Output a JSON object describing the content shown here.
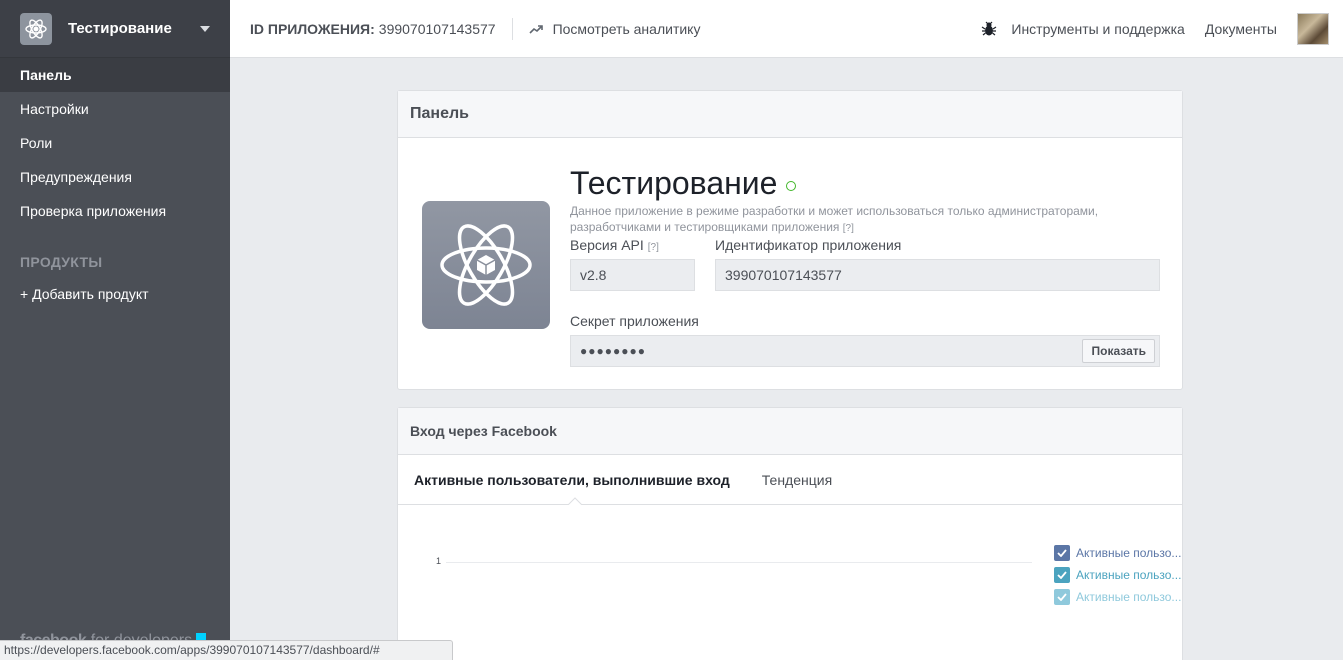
{
  "sidebar": {
    "app_name": "Тестирование",
    "nav": [
      "Панель",
      "Настройки",
      "Роли",
      "Предупреждения",
      "Проверка приложения"
    ],
    "products_heading": "ПРОДУКТЫ",
    "add_product": "+ Добавить продукт",
    "brand_bold": "facebook",
    "brand_rest": "for developers"
  },
  "topbar": {
    "app_id_label": "ID ПРИЛОЖЕНИЯ:",
    "app_id_value": "399070107143577",
    "analytics": "Посмотреть аналитику",
    "tools": "Инструменты и поддержка",
    "docs": "Документы"
  },
  "dashboard": {
    "heading": "Панель",
    "app_title": "Тестирование",
    "description": "Данное приложение в режиме разработки и может использоваться только администраторами, разработчиками и тестировщиками приложения",
    "help_mark": "[?]",
    "api_version_label": "Версия API",
    "api_version_value": "v2.8",
    "app_id_label": "Идентификатор приложения",
    "app_id_value": "399070107143577",
    "secret_label": "Секрет приложения",
    "secret_value": "●●●●●●●●",
    "show_button": "Показать"
  },
  "login_card": {
    "heading": "Вход через Facebook",
    "tabs": [
      "Активные пользователи, выполнившие вход",
      "Тенденция"
    ],
    "y_tick": "1",
    "legend": [
      {
        "label": "Активные пользо...",
        "color": "#5b76a6"
      },
      {
        "label": "Активные пользо...",
        "color": "#4ba3bf"
      },
      {
        "label": "Активные пользо...",
        "color": "#8fc9dc"
      }
    ]
  },
  "statusbar": {
    "url": "https://developers.facebook.com/apps/399070107143577/dashboard/#"
  }
}
